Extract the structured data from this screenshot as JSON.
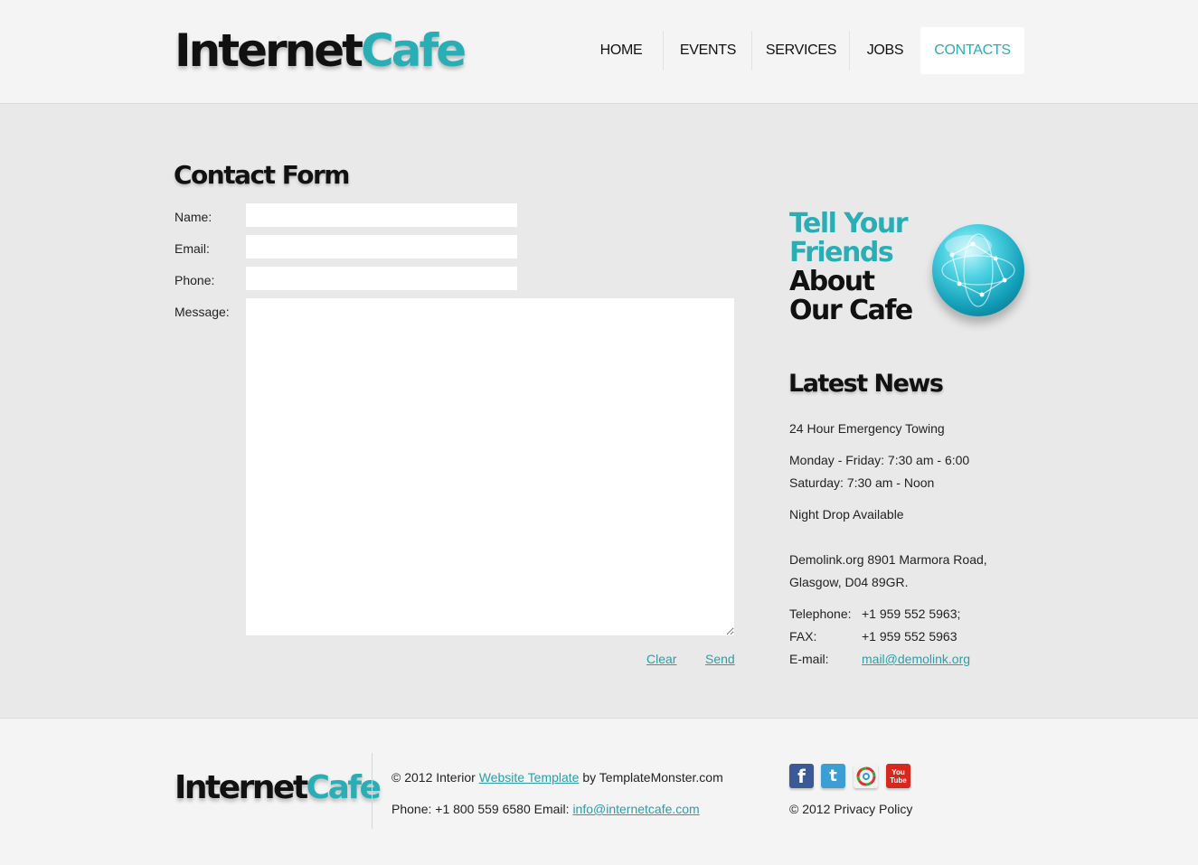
{
  "brand": {
    "name_part1": "Internet",
    "name_part2": "Cafe",
    "accent": "#2aaeb5"
  },
  "nav": {
    "items": [
      {
        "label": "HOME"
      },
      {
        "label": "EVENTS"
      },
      {
        "label": "SERVICES"
      },
      {
        "label": "JOBS"
      },
      {
        "label": "CONTACTS",
        "active": true
      }
    ]
  },
  "contact_form": {
    "title": "Contact Form",
    "name_label": "Name:",
    "email_label": "Email:",
    "phone_label": "Phone:",
    "message_label": "Message:",
    "name_value": "",
    "email_value": "",
    "phone_value": "",
    "message_value": "",
    "clear_label": "Clear",
    "send_label": "Send"
  },
  "promo": {
    "line1": "Tell Your",
    "line2": "Friends",
    "line3": "About",
    "line4": "Our Cafe",
    "icon": "globe-icon"
  },
  "news": {
    "title": "Latest News",
    "item1": "24 Hour Emergency Towing",
    "hours1": "Monday - Friday: 7:30 am - 6:00",
    "hours2": "Saturday: 7:30 am - Noon",
    "item2": "Night Drop Available",
    "address1": "Demolink.org 8901 Marmora Road,",
    "address2": "Glasgow, D04 89GR.",
    "telephone_label": "Telephone:",
    "telephone_value": "+1 959 552 5963;",
    "fax_label": "FAX:",
    "fax_value": "+1 959 552 5963",
    "email_label": "E-mail:",
    "email_value": "mail@demolink.org"
  },
  "footer": {
    "copyright_prefix": "© 2012 Interior",
    "template_link": "Website Template",
    "copyright_suffix": "by TemplateMonster.com",
    "contact_prefix": "Phone: +1 800 559 6580 Email:",
    "contact_email": "info@internetcafe.com",
    "privacy": "© 2012 Privacy Policy",
    "social": [
      {
        "icon": "facebook-icon",
        "glyph": "f",
        "color": "#3b5998"
      },
      {
        "icon": "twitter-icon",
        "glyph": "t",
        "color": "#3b9fd6"
      },
      {
        "icon": "picasa-icon",
        "glyph": "✿",
        "color": "#ffffff"
      },
      {
        "icon": "youtube-icon",
        "glyph_top": "You",
        "glyph_bottom": "Tube",
        "color": "#d8281e"
      }
    ]
  }
}
